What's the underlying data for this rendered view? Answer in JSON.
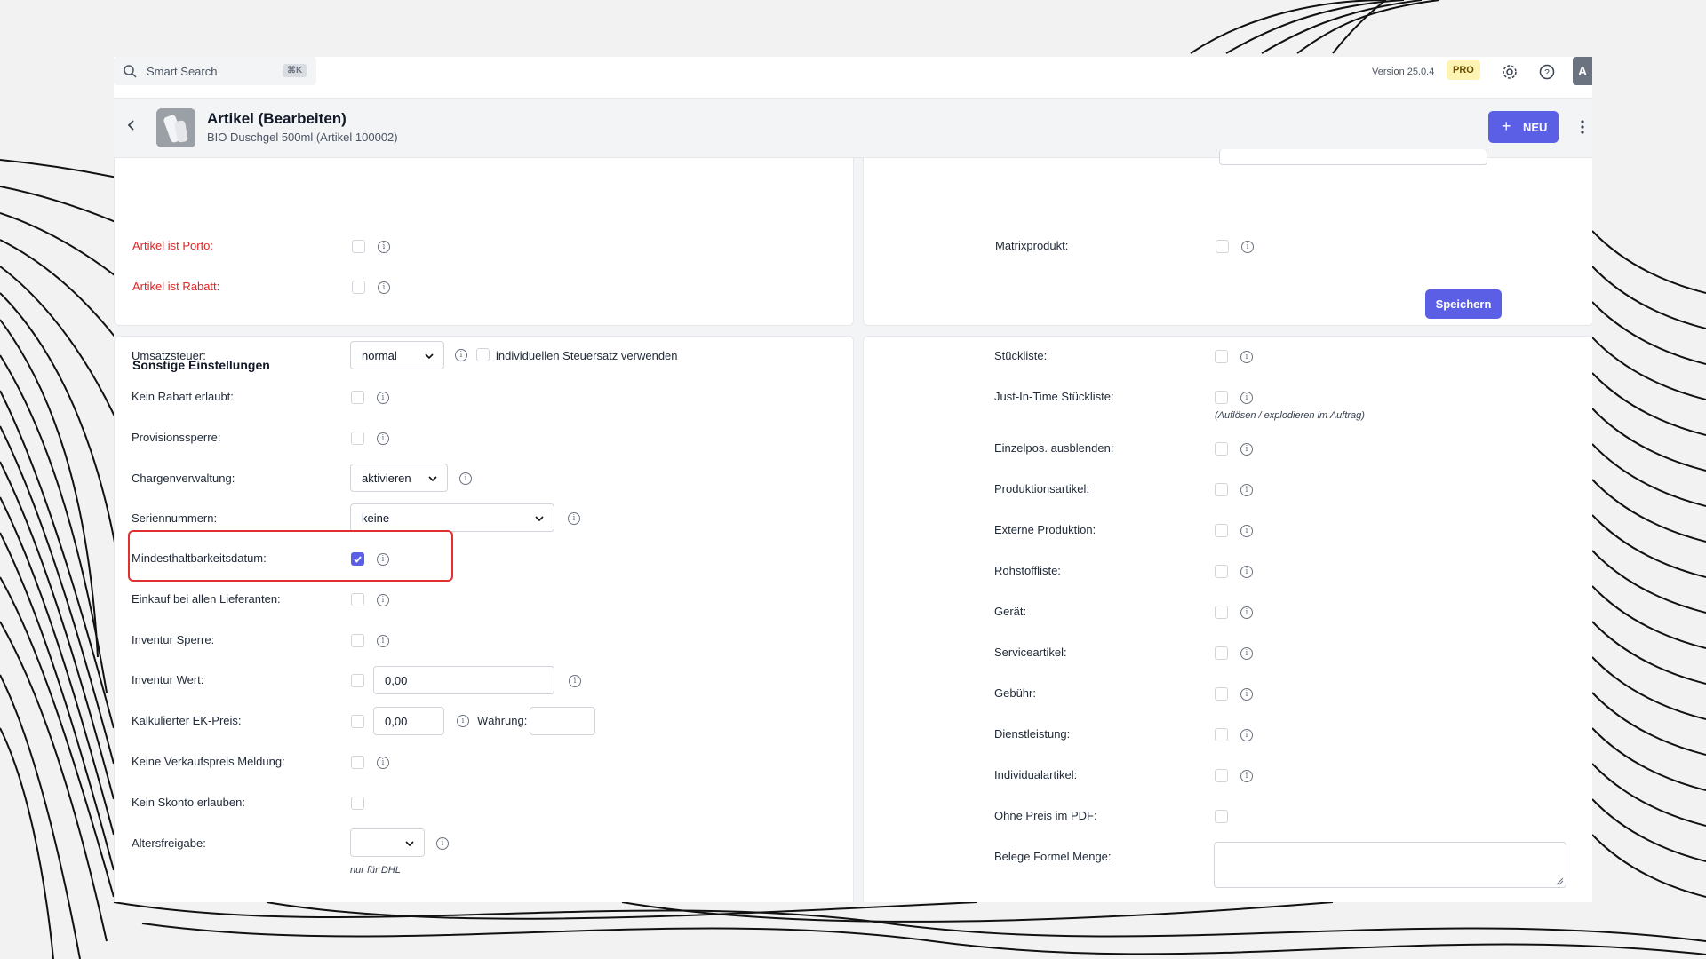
{
  "search": {
    "placeholder": "Smart Search",
    "shortcut": "⌘K"
  },
  "topbar": {
    "version": "Version 25.0.4",
    "plan_badge": "PRO",
    "avatar_initial": "A"
  },
  "header": {
    "title": "Artikel (Bearbeiten)",
    "subtitle": "BIO Duschgel 500ml (Artikel 100002)",
    "new_button": "NEU"
  },
  "top_left": {
    "rows": [
      {
        "label": "Artikel ist Porto:",
        "checked": false
      },
      {
        "label": "Artikel ist Rabatt:",
        "checked": false
      }
    ]
  },
  "top_right": {
    "rows": [
      {
        "label": "Matrixprodukt:",
        "checked": false
      }
    ],
    "save_button": "Speichern"
  },
  "sonstige": {
    "title": "Sonstige Einstellungen",
    "umsatzsteuer": {
      "label": "Umsatzsteuer:",
      "value": "normal",
      "checkbox_label": "individuellen Steuersatz verwenden"
    },
    "kein_rabatt": {
      "label": "Kein Rabatt erlaubt:"
    },
    "provisionssperre": {
      "label": "Provisionssperre:"
    },
    "chargen": {
      "label": "Chargenverwaltung:",
      "value": "aktivieren"
    },
    "serien": {
      "label": "Seriennummern:",
      "value": "keine"
    },
    "mhd": {
      "label": "Mindesthaltbarkeitsdatum:",
      "checked": true
    },
    "einkauf": {
      "label": "Einkauf bei allen Lieferanten:"
    },
    "inventur_sperre": {
      "label": "Inventur Sperre:"
    },
    "inventur_wert": {
      "label": "Inventur Wert:",
      "value": "0,00"
    },
    "ek_preis": {
      "label": "Kalkulierter EK-Preis:",
      "value": "0,00",
      "currency_label": "Währung:",
      "currency_value": ""
    },
    "keine_vk": {
      "label": "Keine Verkaufspreis Meldung:"
    },
    "kein_skonto": {
      "label": "Kein Skonto erlauben:"
    },
    "altersfreigabe": {
      "label": "Altersfreigabe:",
      "value": "",
      "hint": "nur für DHL"
    }
  },
  "right_panel": {
    "stueckliste": {
      "label": "Stückliste:"
    },
    "jit": {
      "label": "Just-In-Time Stückliste:",
      "hint": "(Auflösen / explodieren im Auftrag)"
    },
    "einzelpos": {
      "label": "Einzelpos. ausblenden:"
    },
    "produktion": {
      "label": "Produktionsartikel:"
    },
    "extern": {
      "label": "Externe Produktion:"
    },
    "rohstoff": {
      "label": "Rohstoffliste:"
    },
    "geraet": {
      "label": "Gerät:"
    },
    "service": {
      "label": "Serviceartikel:"
    },
    "gebuehr": {
      "label": "Gebühr:"
    },
    "dienst": {
      "label": "Dienstleistung:"
    },
    "individual": {
      "label": "Individualartikel:"
    },
    "ohne_preis": {
      "label": "Ohne Preis im PDF:"
    },
    "formel": {
      "label": "Belege Formel Menge:",
      "value": ""
    }
  }
}
